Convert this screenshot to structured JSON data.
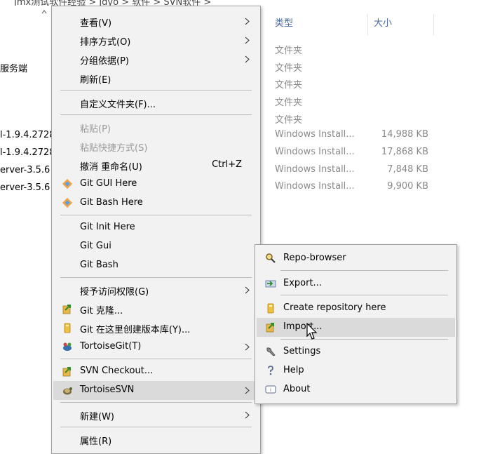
{
  "breadcrumb_fragment": "Jmx测试软件经验  >  Jdyo  >  软件  >  SVN软件  >",
  "left_list": [
    "服务端",
    "l-1.9.4.2728",
    "l-1.9.4.2728",
    "erver-3.5.6",
    "erver-3.5.6"
  ],
  "columns": {
    "type": "类型",
    "size": "大小"
  },
  "rows": [
    {
      "type": "文件夹",
      "size": ""
    },
    {
      "type": "文件夹",
      "size": ""
    },
    {
      "type": "文件夹",
      "size": ""
    },
    {
      "type": "文件夹",
      "size": ""
    },
    {
      "type": "文件夹",
      "size": ""
    },
    {
      "type": "Windows Install...",
      "size": "14,988 KB"
    },
    {
      "type": "Windows Install...",
      "size": "17,868 KB"
    },
    {
      "type": "Windows Install...",
      "size": "7,848 KB"
    },
    {
      "type": "Windows Install...",
      "size": "9,900 KB"
    }
  ],
  "context_menu": {
    "view": "查看(V)",
    "sort_by": "排序方式(O)",
    "group_by": "分组依据(P)",
    "refresh": "刷新(E)",
    "customize_folder": "自定义文件夹(F)...",
    "paste": "粘贴(P)",
    "paste_shortcut": "粘贴快捷方式(S)",
    "undo_rename": "撤消 重命名(U)",
    "undo_shortcut": "Ctrl+Z",
    "git_gui_here": "Git GUI Here",
    "git_bash_here": "Git Bash Here",
    "git_init_here": "Git Init Here",
    "git_gui": "Git Gui",
    "git_bash": "Git Bash",
    "grant_access": "授予访问权限(G)",
    "git_clone": "Git 克隆...",
    "git_create_repo": "Git 在这里创建版本库(Y)...",
    "tortoise_git": "TortoiseGit(T)",
    "svn_checkout": "SVN Checkout...",
    "tortoise_svn": "TortoiseSVN",
    "new": "新建(W)",
    "properties": "属性(R)"
  },
  "svn_submenu": {
    "repo_browser": "Repo-browser",
    "export": "Export...",
    "create_repo": "Create repository here",
    "import": "Import...",
    "settings": "Settings",
    "help": "Help",
    "about": "About"
  },
  "colors": {
    "menu_bg": "#f2f2f2",
    "hover": "#dadada",
    "header_blue": "#4a6aa0"
  }
}
